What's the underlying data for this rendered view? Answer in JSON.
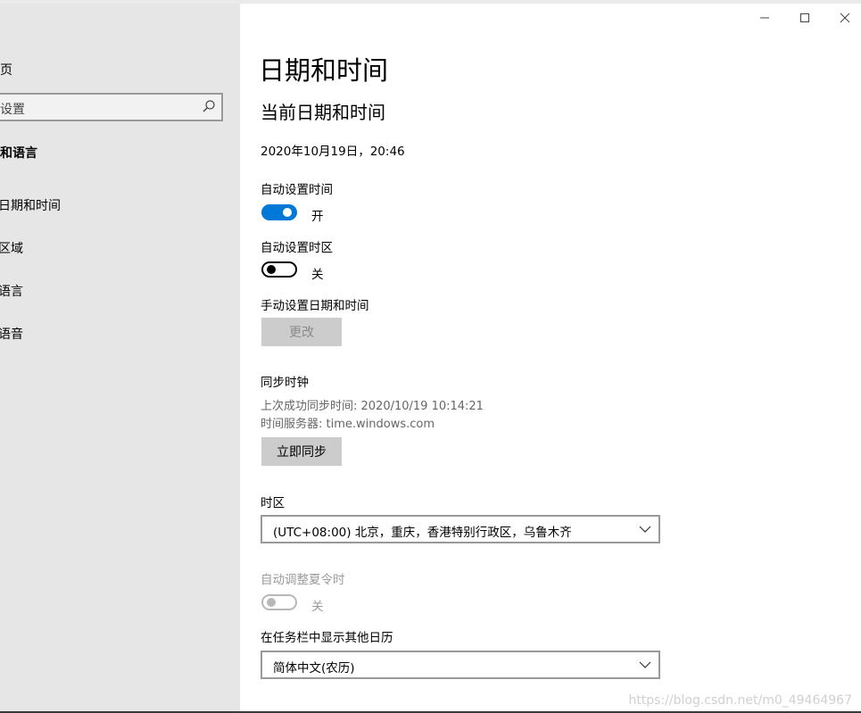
{
  "window": {
    "minimize_glyph": "—",
    "maximize_glyph": "☐",
    "close_glyph": "✕"
  },
  "sidebar": {
    "home": "主页",
    "search_placeholder": "找设置",
    "section_title": "时间和语言",
    "items": [
      {
        "label": "日期和时间"
      },
      {
        "label": "区域"
      },
      {
        "label": "语言"
      },
      {
        "label": "语音"
      }
    ]
  },
  "main": {
    "page_title": "日期和时间",
    "section_title": "当前日期和时间",
    "current_datetime": "2020年10月19日，20:46",
    "auto_time": {
      "label": "自动设置时间",
      "state": "开",
      "on": true
    },
    "auto_timezone": {
      "label": "自动设置时区",
      "state": "关",
      "on": false
    },
    "manual": {
      "label": "手动设置日期和时间",
      "button": "更改"
    },
    "sync": {
      "title": "同步时钟",
      "last_sync": "上次成功同步时间: 2020/10/19 10:14:21",
      "server": "时间服务器: time.windows.com",
      "button": "立即同步"
    },
    "timezone": {
      "label": "时区",
      "value": "(UTC+08:00) 北京，重庆，香港特别行政区，乌鲁木齐"
    },
    "dst": {
      "label": "自动调整夏令时",
      "state": "关",
      "on": false,
      "disabled": true
    },
    "calendar": {
      "label": "在任务栏中显示其他日历",
      "value": "简体中文(农历)"
    }
  },
  "watermark": "https://blog.csdn.net/m0_49464967",
  "colors": {
    "accent": "#0078d7",
    "sidebar_bg": "#e6e6e6"
  }
}
